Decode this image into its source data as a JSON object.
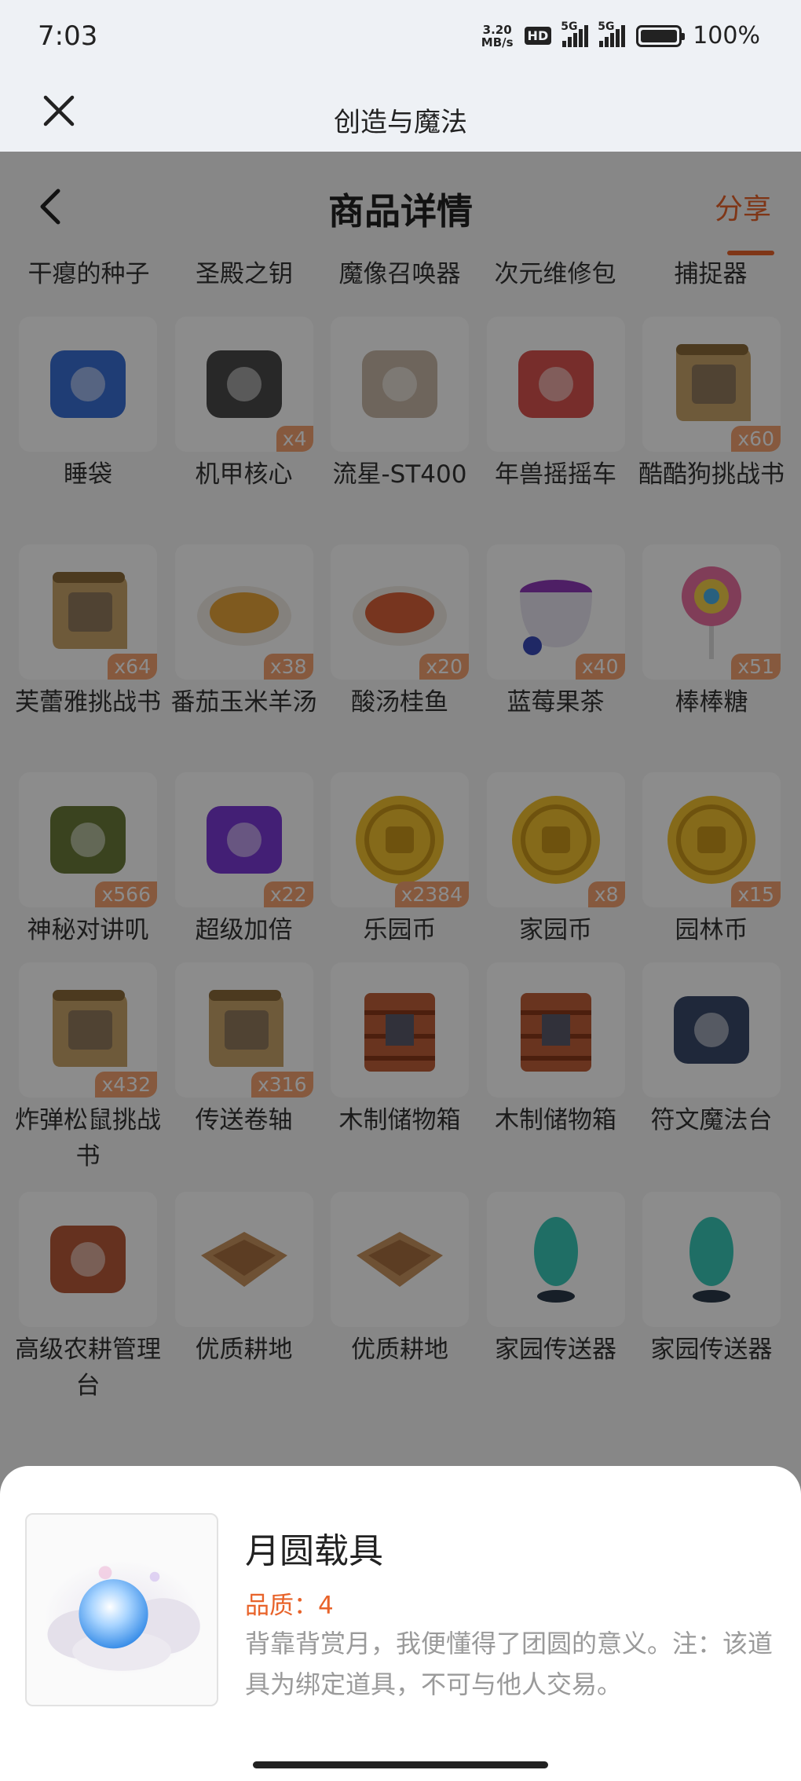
{
  "status": {
    "time": "7:03",
    "net_speed_top": "3.20",
    "net_speed_bottom": "MB/s",
    "hd": "HD",
    "signal1": "5G",
    "signal2": "5G",
    "battery": "100%"
  },
  "appbar": {
    "title": "创造与魔法",
    "close_icon": "close-icon"
  },
  "nav": {
    "title": "商品详情",
    "share": "分享",
    "accent": "#e8632a"
  },
  "top_row": [
    "干瘪的种子",
    "圣殿之钥",
    "魔像召唤器",
    "次元维修包",
    "捕捉器"
  ],
  "items": [
    {
      "name": "睡袋",
      "count": "",
      "icon": "sleeping-bag-icon",
      "color": "#3a6fd6"
    },
    {
      "name": "机甲核心",
      "count": "x4",
      "icon": "mech-core-icon",
      "color": "#4a4a4a"
    },
    {
      "name": "流星-ST400",
      "count": "",
      "icon": "vehicle-icon",
      "color": "#c8b8a8"
    },
    {
      "name": "年兽摇摇车",
      "count": "",
      "icon": "rocking-car-icon",
      "color": "#d9534f"
    },
    {
      "name": "酷酷狗挑战书",
      "count": "x60",
      "icon": "wanted-scroll-icon",
      "color": "#c8a46a"
    },
    {
      "name": "芙蕾雅挑战书",
      "count": "x64",
      "icon": "wanted-scroll-icon",
      "color": "#c8a46a"
    },
    {
      "name": "番茄玉米羊汤",
      "count": "x38",
      "icon": "soup-icon",
      "color": "#e8a43a"
    },
    {
      "name": "酸汤桂鱼",
      "count": "x20",
      "icon": "fish-dish-icon",
      "color": "#d9613a"
    },
    {
      "name": "蓝莓果茶",
      "count": "x40",
      "icon": "tea-cup-icon",
      "color": "#8e3ab8"
    },
    {
      "name": "棒棒糖",
      "count": "x51",
      "icon": "lollipop-icon",
      "color": "#e96fa0"
    },
    {
      "name": "神秘对讲叽",
      "count": "x566",
      "icon": "walkie-talkie-icon",
      "color": "#6a7a3a"
    },
    {
      "name": "超级加倍",
      "count": "x22",
      "icon": "cards-icon",
      "color": "#7a3ad6"
    },
    {
      "name": "乐园币",
      "count": "x2384",
      "icon": "coin-icon",
      "color": "#f2c230"
    },
    {
      "name": "家园币",
      "count": "x8",
      "icon": "coin-icon",
      "color": "#f2c230"
    },
    {
      "name": "园林币",
      "count": "x15",
      "icon": "coin-icon",
      "color": "#f2c230"
    },
    {
      "name": "炸弹松鼠挑战书",
      "count": "x432",
      "icon": "wanted-scroll-icon",
      "color": "#c8a46a"
    },
    {
      "name": "传送卷轴",
      "count": "x316",
      "icon": "teleport-scroll-icon",
      "color": "#c8a46a"
    },
    {
      "name": "木制储物箱",
      "count": "",
      "icon": "wooden-chest-icon",
      "color": "#c0603a"
    },
    {
      "name": "木制储物箱",
      "count": "",
      "icon": "wooden-chest-icon",
      "color": "#c0603a"
    },
    {
      "name": "符文魔法台",
      "count": "",
      "icon": "rune-altar-icon",
      "color": "#3a4a6a"
    },
    {
      "name": "高级农耕管理台",
      "count": "",
      "icon": "farm-station-icon",
      "color": "#b85a3a"
    },
    {
      "name": "优质耕地",
      "count": "",
      "icon": "farmland-icon",
      "color": "#c89460"
    },
    {
      "name": "优质耕地",
      "count": "",
      "icon": "farmland-icon",
      "color": "#c89460"
    },
    {
      "name": "家园传送器",
      "count": "",
      "icon": "teleporter-icon",
      "color": "#3ac8b8"
    },
    {
      "name": "家园传送器",
      "count": "",
      "icon": "teleporter-icon",
      "color": "#3ac8b8"
    }
  ],
  "sheet": {
    "name": "月圆载具",
    "quality": "品质：4",
    "description": "背靠背赏月，我便懂得了团圆的意义。注：该道具为绑定道具，不可与他人交易。",
    "icon": "moon-vehicle-icon"
  }
}
